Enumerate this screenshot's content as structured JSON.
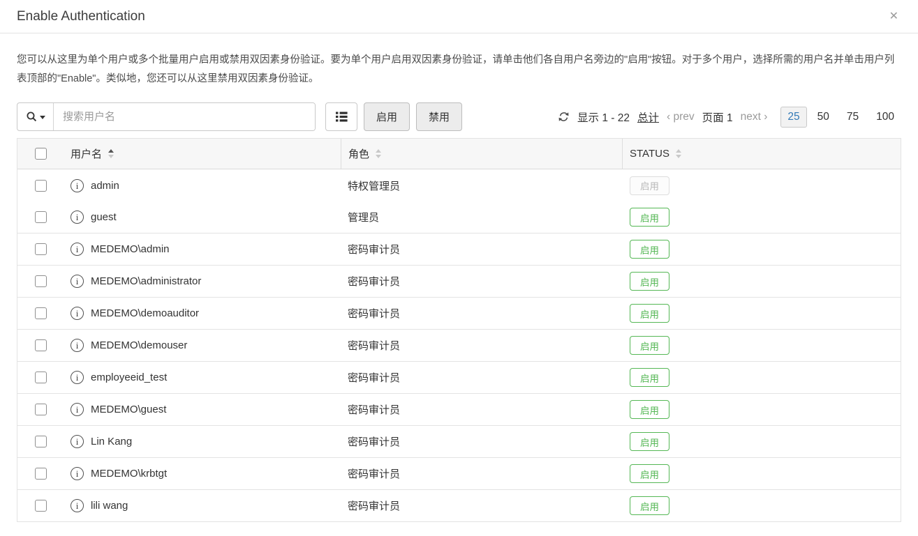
{
  "header": {
    "title": "Enable Authentication"
  },
  "icons": {
    "close": "✕",
    "info": "i",
    "prev_angle": "‹",
    "next_angle": "›"
  },
  "description": "您可以从这里为单个用户或多个批量用户启用或禁用双因素身份验证。要为单个用户启用双因素身份验证，请单击他们各自用户名旁边的\"启用\"按钮。对于多个用户，选择所需的用户名并单击用户列表顶部的\"Enable\"。类似地，您还可以从这里禁用双因素身份验证。",
  "toolbar": {
    "search_placeholder": "搜索用户名",
    "enable_label": "启用",
    "disable_label": "禁用"
  },
  "pagination": {
    "summary": "显示 1 - 22",
    "total_link": "总计",
    "prev_label": "prev",
    "page_indicator": "页面 1",
    "next_label": "next",
    "page_sizes": [
      "25",
      "50",
      "75",
      "100"
    ],
    "active_page_size": "25"
  },
  "table": {
    "headers": {
      "username": "用户名",
      "role": "角色",
      "status": "STATUS"
    },
    "rows": [
      {
        "username": "admin",
        "role": "特权管理员",
        "action": "启用",
        "action_enabled": false
      },
      {
        "username": "guest",
        "role": "管理员",
        "action": "启用",
        "action_enabled": true
      },
      {
        "username": "MEDEMO\\admin",
        "role": "密码审计员",
        "action": "启用",
        "action_enabled": true
      },
      {
        "username": "MEDEMO\\administrator",
        "role": "密码审计员",
        "action": "启用",
        "action_enabled": true
      },
      {
        "username": "MEDEMO\\demoauditor",
        "role": "密码审计员",
        "action": "启用",
        "action_enabled": true
      },
      {
        "username": "MEDEMO\\demouser",
        "role": "密码审计员",
        "action": "启用",
        "action_enabled": true
      },
      {
        "username": "employeeid_test",
        "role": "密码审计员",
        "action": "启用",
        "action_enabled": true
      },
      {
        "username": "MEDEMO\\guest",
        "role": "密码审计员",
        "action": "启用",
        "action_enabled": true
      },
      {
        "username": "Lin Kang",
        "role": "密码审计员",
        "action": "启用",
        "action_enabled": true
      },
      {
        "username": "MEDEMO\\krbtgt",
        "role": "密码审计员",
        "action": "启用",
        "action_enabled": true
      },
      {
        "username": "lili wang",
        "role": "密码审计员",
        "action": "启用",
        "action_enabled": true
      }
    ]
  },
  "colors": {
    "accent_green": "#54b754",
    "link_blue": "#337ab7"
  }
}
